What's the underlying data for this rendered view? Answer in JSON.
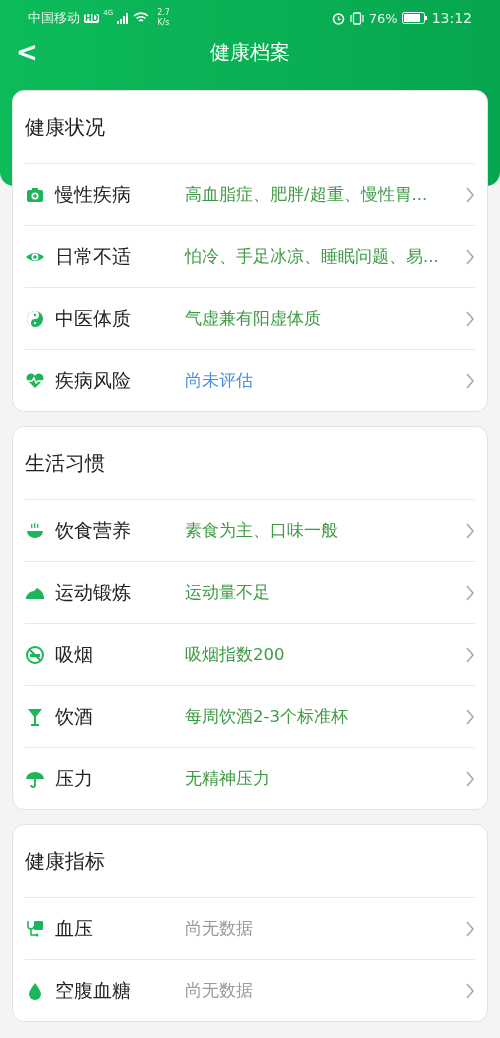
{
  "status_bar": {
    "carrier": "中国移动",
    "hd": "HD",
    "network": "4G",
    "speed": "2.7",
    "speed_unit": "K/s",
    "battery": "76%",
    "time": "13:12"
  },
  "header": {
    "back": "<",
    "title": "健康档案"
  },
  "sections": [
    {
      "title": "健康状况",
      "rows": [
        {
          "label": "慢性疾病",
          "value": "高血脂症、肥胖/超重、慢性胃...",
          "kind": "filled"
        },
        {
          "label": "日常不适",
          "value": "怕冷、手足冰凉、睡眠问题、易...",
          "kind": "filled"
        },
        {
          "label": "中医体质",
          "value": "气虚兼有阳虚体质",
          "kind": "filled"
        },
        {
          "label": "疾病风险",
          "value": "尚未评估",
          "kind": "pending"
        }
      ]
    },
    {
      "title": "生活习惯",
      "rows": [
        {
          "label": "饮食营养",
          "value": "素食为主、口味一般",
          "kind": "filled"
        },
        {
          "label": "运动锻炼",
          "value": "运动量不足",
          "kind": "filled"
        },
        {
          "label": "吸烟",
          "value": "吸烟指数200",
          "kind": "filled"
        },
        {
          "label": "饮酒",
          "value": "每周饮酒2-3个标准杯",
          "kind": "filled"
        },
        {
          "label": "压力",
          "value": "无精神压力",
          "kind": "filled"
        }
      ]
    },
    {
      "title": "健康指标",
      "rows": [
        {
          "label": "血压",
          "value": "尚无数据",
          "kind": "empty"
        },
        {
          "label": "空腹血糖",
          "value": "尚无数据",
          "kind": "empty"
        }
      ]
    }
  ]
}
